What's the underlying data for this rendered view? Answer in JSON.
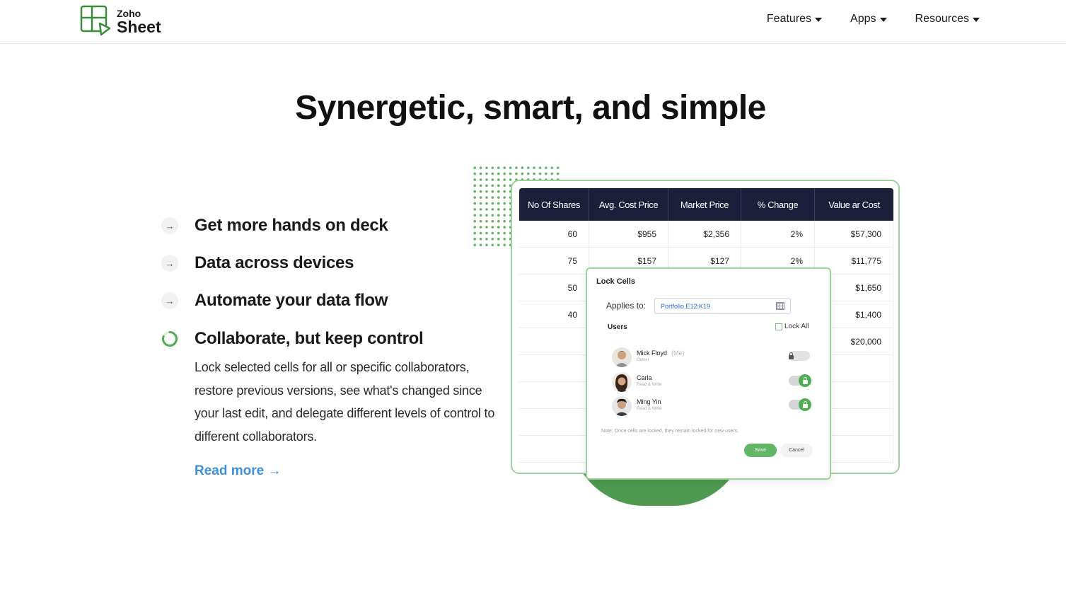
{
  "header": {
    "logo_small": "Zoho",
    "logo_large": "Sheet",
    "nav": [
      {
        "label": "Features"
      },
      {
        "label": "Apps"
      },
      {
        "label": "Resources"
      }
    ]
  },
  "headline": "Synergetic, smart, and simple",
  "features": [
    {
      "title": "Get more hands on deck"
    },
    {
      "title": "Data across devices"
    },
    {
      "title": "Automate your data flow"
    },
    {
      "title": "Collaborate, but keep control"
    }
  ],
  "active_description": "Lock selected cells for all or specific collaborators, restore previous versions, see what's changed since your last edit, and delegate different levels of control to different collaborators.",
  "read_more": "Read more →",
  "sheet": {
    "headers": [
      "No Of Shares",
      "Avg. Cost Price",
      "Market Price",
      "% Change",
      "Value ar Cost"
    ],
    "rows": [
      [
        "60",
        "$955",
        "$2,356",
        "2%",
        "$57,300"
      ],
      [
        "75",
        "$157",
        "$127",
        "2%",
        "$11,775"
      ],
      [
        "50",
        "",
        "",
        "",
        "$1,650"
      ],
      [
        "40",
        "",
        "",
        "",
        "$1,400"
      ],
      [
        "",
        "",
        "",
        "",
        "$20,000"
      ],
      [
        "",
        "",
        "",
        "",
        ""
      ],
      [
        "",
        "",
        "",
        "",
        ""
      ],
      [
        "",
        "",
        "",
        "",
        ""
      ],
      [
        "",
        "",
        "",
        "",
        ""
      ]
    ]
  },
  "dialog": {
    "title": "Lock Cells",
    "applies_label": "Applies to:",
    "range": "Portfolio.E12:K19",
    "users_label": "Users",
    "lock_all": "Lock All",
    "users": [
      {
        "name": "Mick Floyd",
        "tag": "(Me)",
        "role": "Owner",
        "locked": false
      },
      {
        "name": "Carla",
        "tag": "",
        "role": "Read & Write",
        "locked": true
      },
      {
        "name": "Ming Yin",
        "tag": "",
        "role": "Read & Write",
        "locked": true
      }
    ],
    "note": "Note: Once cells are locked, they remain locked for new users.",
    "save": "Save",
    "cancel": "Cancel"
  },
  "colors": {
    "brand_green": "#4f9a50",
    "link_blue": "#3d8fd9",
    "table_header": "#1b1f3a"
  }
}
